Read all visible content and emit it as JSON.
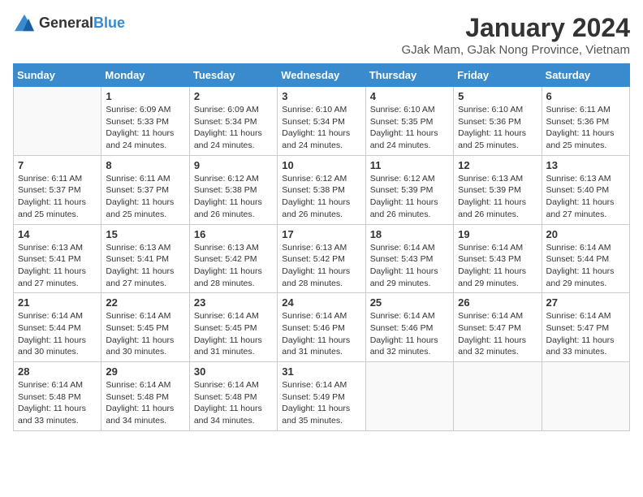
{
  "header": {
    "logo_general": "General",
    "logo_blue": "Blue",
    "title": "January 2024",
    "subtitle": "GJak Mam, GJak Nong Province, Vietnam"
  },
  "weekdays": [
    "Sunday",
    "Monday",
    "Tuesday",
    "Wednesday",
    "Thursday",
    "Friday",
    "Saturday"
  ],
  "weeks": [
    [
      {
        "day": "",
        "sunrise": "",
        "sunset": "",
        "daylight": ""
      },
      {
        "day": "1",
        "sunrise": "Sunrise: 6:09 AM",
        "sunset": "Sunset: 5:33 PM",
        "daylight": "Daylight: 11 hours and 24 minutes."
      },
      {
        "day": "2",
        "sunrise": "Sunrise: 6:09 AM",
        "sunset": "Sunset: 5:34 PM",
        "daylight": "Daylight: 11 hours and 24 minutes."
      },
      {
        "day": "3",
        "sunrise": "Sunrise: 6:10 AM",
        "sunset": "Sunset: 5:34 PM",
        "daylight": "Daylight: 11 hours and 24 minutes."
      },
      {
        "day": "4",
        "sunrise": "Sunrise: 6:10 AM",
        "sunset": "Sunset: 5:35 PM",
        "daylight": "Daylight: 11 hours and 24 minutes."
      },
      {
        "day": "5",
        "sunrise": "Sunrise: 6:10 AM",
        "sunset": "Sunset: 5:36 PM",
        "daylight": "Daylight: 11 hours and 25 minutes."
      },
      {
        "day": "6",
        "sunrise": "Sunrise: 6:11 AM",
        "sunset": "Sunset: 5:36 PM",
        "daylight": "Daylight: 11 hours and 25 minutes."
      }
    ],
    [
      {
        "day": "7",
        "sunrise": "Sunrise: 6:11 AM",
        "sunset": "Sunset: 5:37 PM",
        "daylight": "Daylight: 11 hours and 25 minutes."
      },
      {
        "day": "8",
        "sunrise": "Sunrise: 6:11 AM",
        "sunset": "Sunset: 5:37 PM",
        "daylight": "Daylight: 11 hours and 25 minutes."
      },
      {
        "day": "9",
        "sunrise": "Sunrise: 6:12 AM",
        "sunset": "Sunset: 5:38 PM",
        "daylight": "Daylight: 11 hours and 26 minutes."
      },
      {
        "day": "10",
        "sunrise": "Sunrise: 6:12 AM",
        "sunset": "Sunset: 5:38 PM",
        "daylight": "Daylight: 11 hours and 26 minutes."
      },
      {
        "day": "11",
        "sunrise": "Sunrise: 6:12 AM",
        "sunset": "Sunset: 5:39 PM",
        "daylight": "Daylight: 11 hours and 26 minutes."
      },
      {
        "day": "12",
        "sunrise": "Sunrise: 6:13 AM",
        "sunset": "Sunset: 5:39 PM",
        "daylight": "Daylight: 11 hours and 26 minutes."
      },
      {
        "day": "13",
        "sunrise": "Sunrise: 6:13 AM",
        "sunset": "Sunset: 5:40 PM",
        "daylight": "Daylight: 11 hours and 27 minutes."
      }
    ],
    [
      {
        "day": "14",
        "sunrise": "Sunrise: 6:13 AM",
        "sunset": "Sunset: 5:41 PM",
        "daylight": "Daylight: 11 hours and 27 minutes."
      },
      {
        "day": "15",
        "sunrise": "Sunrise: 6:13 AM",
        "sunset": "Sunset: 5:41 PM",
        "daylight": "Daylight: 11 hours and 27 minutes."
      },
      {
        "day": "16",
        "sunrise": "Sunrise: 6:13 AM",
        "sunset": "Sunset: 5:42 PM",
        "daylight": "Daylight: 11 hours and 28 minutes."
      },
      {
        "day": "17",
        "sunrise": "Sunrise: 6:13 AM",
        "sunset": "Sunset: 5:42 PM",
        "daylight": "Daylight: 11 hours and 28 minutes."
      },
      {
        "day": "18",
        "sunrise": "Sunrise: 6:14 AM",
        "sunset": "Sunset: 5:43 PM",
        "daylight": "Daylight: 11 hours and 29 minutes."
      },
      {
        "day": "19",
        "sunrise": "Sunrise: 6:14 AM",
        "sunset": "Sunset: 5:43 PM",
        "daylight": "Daylight: 11 hours and 29 minutes."
      },
      {
        "day": "20",
        "sunrise": "Sunrise: 6:14 AM",
        "sunset": "Sunset: 5:44 PM",
        "daylight": "Daylight: 11 hours and 29 minutes."
      }
    ],
    [
      {
        "day": "21",
        "sunrise": "Sunrise: 6:14 AM",
        "sunset": "Sunset: 5:44 PM",
        "daylight": "Daylight: 11 hours and 30 minutes."
      },
      {
        "day": "22",
        "sunrise": "Sunrise: 6:14 AM",
        "sunset": "Sunset: 5:45 PM",
        "daylight": "Daylight: 11 hours and 30 minutes."
      },
      {
        "day": "23",
        "sunrise": "Sunrise: 6:14 AM",
        "sunset": "Sunset: 5:45 PM",
        "daylight": "Daylight: 11 hours and 31 minutes."
      },
      {
        "day": "24",
        "sunrise": "Sunrise: 6:14 AM",
        "sunset": "Sunset: 5:46 PM",
        "daylight": "Daylight: 11 hours and 31 minutes."
      },
      {
        "day": "25",
        "sunrise": "Sunrise: 6:14 AM",
        "sunset": "Sunset: 5:46 PM",
        "daylight": "Daylight: 11 hours and 32 minutes."
      },
      {
        "day": "26",
        "sunrise": "Sunrise: 6:14 AM",
        "sunset": "Sunset: 5:47 PM",
        "daylight": "Daylight: 11 hours and 32 minutes."
      },
      {
        "day": "27",
        "sunrise": "Sunrise: 6:14 AM",
        "sunset": "Sunset: 5:47 PM",
        "daylight": "Daylight: 11 hours and 33 minutes."
      }
    ],
    [
      {
        "day": "28",
        "sunrise": "Sunrise: 6:14 AM",
        "sunset": "Sunset: 5:48 PM",
        "daylight": "Daylight: 11 hours and 33 minutes."
      },
      {
        "day": "29",
        "sunrise": "Sunrise: 6:14 AM",
        "sunset": "Sunset: 5:48 PM",
        "daylight": "Daylight: 11 hours and 34 minutes."
      },
      {
        "day": "30",
        "sunrise": "Sunrise: 6:14 AM",
        "sunset": "Sunset: 5:48 PM",
        "daylight": "Daylight: 11 hours and 34 minutes."
      },
      {
        "day": "31",
        "sunrise": "Sunrise: 6:14 AM",
        "sunset": "Sunset: 5:49 PM",
        "daylight": "Daylight: 11 hours and 35 minutes."
      },
      {
        "day": "",
        "sunrise": "",
        "sunset": "",
        "daylight": ""
      },
      {
        "day": "",
        "sunrise": "",
        "sunset": "",
        "daylight": ""
      },
      {
        "day": "",
        "sunrise": "",
        "sunset": "",
        "daylight": ""
      }
    ]
  ]
}
